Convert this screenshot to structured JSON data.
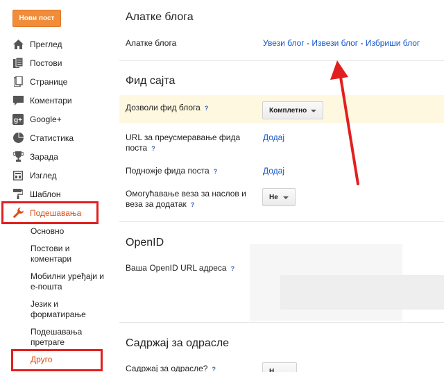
{
  "sidebar": {
    "new_post": "Нови пост",
    "items": [
      {
        "label": "Преглед",
        "icon": "home-icon"
      },
      {
        "label": "Постови",
        "icon": "posts-icon"
      },
      {
        "label": "Странице",
        "icon": "pages-icon"
      },
      {
        "label": "Коментари",
        "icon": "comments-icon"
      },
      {
        "label": "Google+",
        "icon": "google-plus-icon"
      },
      {
        "label": "Статистика",
        "icon": "stats-icon"
      },
      {
        "label": "Зарада",
        "icon": "trophy-icon"
      },
      {
        "label": "Изглед",
        "icon": "layout-icon"
      },
      {
        "label": "Шаблон",
        "icon": "paint-roller-icon"
      },
      {
        "label": "Подешавања",
        "icon": "wrench-icon"
      }
    ],
    "subitems": [
      "Основно",
      "Постови и коментари",
      "Мобилни уређаји и е-пошта",
      "Језик и форматирање",
      "Подешавања претраге",
      "Друго"
    ]
  },
  "tools": {
    "title": "Алатке блога",
    "row_label": "Алатке блога",
    "import": "Увези блог",
    "export": "Извези блог",
    "delete": "Избриши блог",
    "sep": " - "
  },
  "feed": {
    "title": "Фид сајта",
    "allow_label": "Дозволи фид блога",
    "allow_value": "Комплетно",
    "redirect_label": "URL за преусмеравање фида поста",
    "redirect_link": "Додај",
    "footer_label": "Подножје фида поста",
    "footer_link": "Додај",
    "enclosure_label": "Омогућавање веза за наслов и веза за додатак",
    "enclosure_value": "Не"
  },
  "openid": {
    "title": "OpenID",
    "url_label": "Ваша OpenID URL адреса"
  },
  "adult": {
    "title": "Садржај за одрасле",
    "label": "Садржај за одрасле?",
    "value": "Н"
  },
  "help": "?"
}
